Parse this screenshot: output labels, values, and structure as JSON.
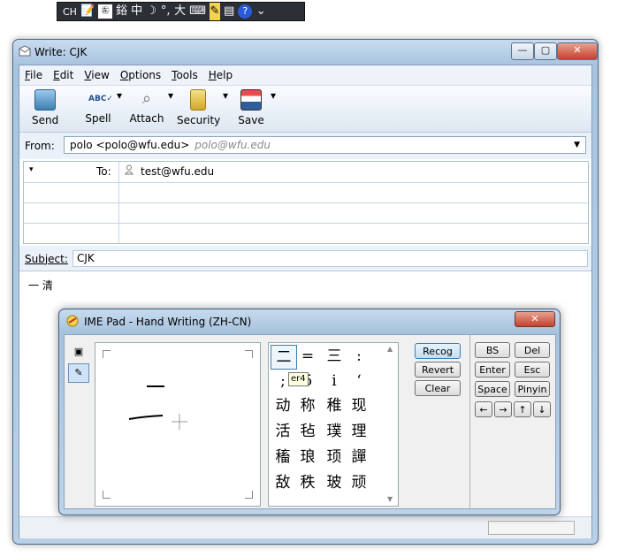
{
  "langbar": {
    "lang": "CH",
    "glyphs": [
      "📝",
      "㊧",
      "鋊",
      "中",
      "☽",
      "°,",
      "大",
      "⌨",
      "✎",
      "▤",
      "?",
      "⌄"
    ]
  },
  "window": {
    "title": "Write: CJK",
    "caption_buttons": {
      "minimize": "—",
      "maximize": "▢",
      "close": "✕"
    }
  },
  "menu": [
    "File",
    "Edit",
    "View",
    "Options",
    "Tools",
    "Help"
  ],
  "toolbar": {
    "send": "Send",
    "spell": "Spell",
    "attach": "Attach",
    "security": "Security",
    "save": "Save",
    "dropdown": "▾"
  },
  "from": {
    "label": "From:",
    "value": "polo <polo@wfu.edu>",
    "hint": "polo@wfu.edu"
  },
  "to": {
    "label": "To:",
    "type_arrow": "▾",
    "value": "test@wfu.edu"
  },
  "subject": {
    "label": "Subject:",
    "value": "CJK"
  },
  "body": {
    "text": "一 清"
  },
  "colors": {
    "accent": "#3c7fb1",
    "close": "#c4412c",
    "chrome": "#b9d0e6"
  },
  "ime": {
    "title": "IME Pad - Hand Writing (ZH-CN)",
    "close": "✕",
    "side_icons": [
      "pad-icon",
      "handwriting-icon"
    ],
    "candidates": [
      [
        "二",
        "=",
        "三",
        ":"
      ],
      [
        ";",
        "5",
        "i",
        "‘"
      ],
      [
        "动",
        "称",
        "稚",
        "现"
      ],
      [
        "活",
        "毡",
        "璞",
        "理"
      ],
      [
        "稸",
        "琅",
        "顼",
        "譂"
      ],
      [
        "敌",
        "秩",
        "玻",
        "顽"
      ]
    ],
    "tooltip": "er4",
    "buttons": {
      "recog": "Recog",
      "revert": "Revert",
      "clear": "Clear"
    },
    "keys": {
      "bs": "BS",
      "del": "Del",
      "enter": "Enter",
      "esc": "Esc",
      "space": "Space",
      "pinyin": "Pinyin"
    },
    "arrows": {
      "left": "←",
      "right": "→",
      "up": "↑",
      "down": "↓"
    },
    "scroll": {
      "up": "▲",
      "down": "▼"
    }
  }
}
